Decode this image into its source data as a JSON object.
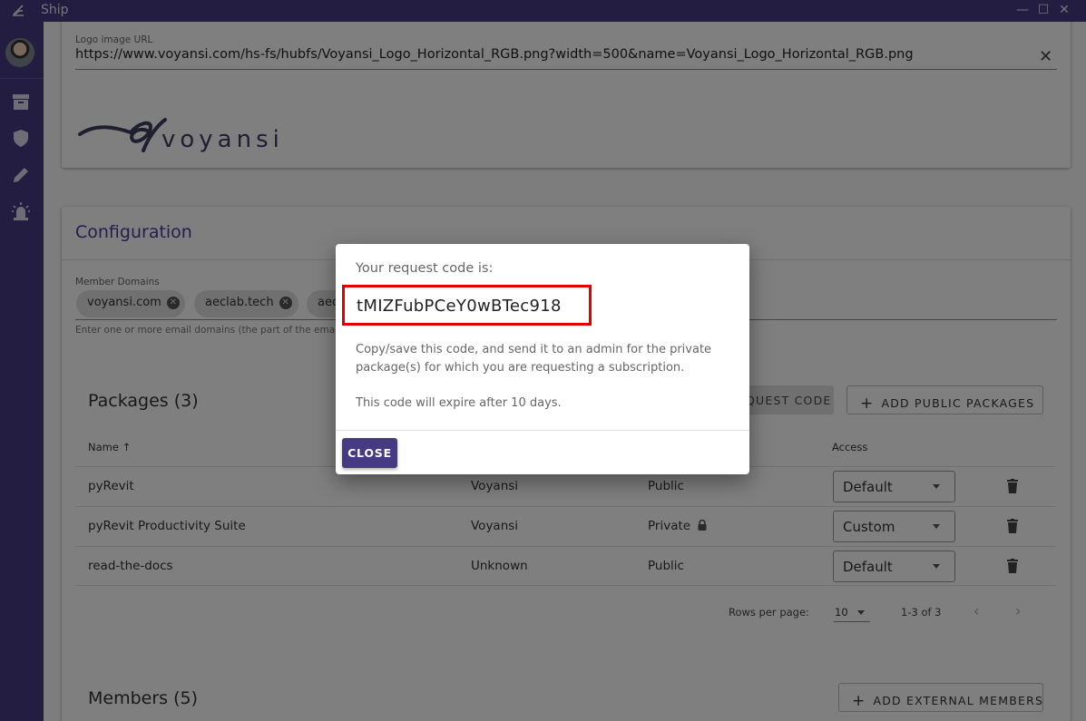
{
  "titlebar": {
    "app_title": "Ship",
    "minimize": "—",
    "maximize": "☐",
    "close": "✕"
  },
  "sidebar": {
    "items": [
      {
        "icon": "archive-icon"
      },
      {
        "icon": "shield-icon"
      },
      {
        "icon": "pencil-icon"
      },
      {
        "icon": "alarm-light-icon"
      }
    ]
  },
  "branding": {
    "logo_url_label": "Logo image URL",
    "logo_url_value": "https://www.voyansi.com/hs-fs/hubfs/Voyansi_Logo_Horizontal_RGB.png?width=500&name=Voyansi_Logo_Horizontal_RGB.png",
    "clear_icon": "✕"
  },
  "configuration": {
    "title": "Configuration",
    "member_domains_label": "Member Domains",
    "domains": [
      "voyansi.com",
      "aeclab.tech",
      "aec"
    ],
    "chip_remove_icon": "✕",
    "domains_help": "Enter one or more email domains (the part of the email"
  },
  "packages": {
    "title": "Packages (3)",
    "request_code_button": "QUEST CODE",
    "add_public_button": "ADD PUBLIC PACKAGES",
    "columns": {
      "name": "Name",
      "sort_icon": "↑",
      "access": "Access"
    },
    "rows": [
      {
        "name": "pyRevit",
        "author": "Voyansi",
        "visibility": "Public",
        "locked": false,
        "access": "Default"
      },
      {
        "name": "pyRevit Productivity Suite",
        "author": "Voyansi",
        "visibility": "Private",
        "locked": true,
        "access": "Custom"
      },
      {
        "name": "read-the-docs",
        "author": "Unknown",
        "visibility": "Public",
        "locked": false,
        "access": "Default"
      }
    ],
    "rows_per_page_label": "Rows per page:",
    "rows_per_page": "10",
    "range": "1-3 of 3"
  },
  "members": {
    "title": "Members (5)",
    "add_external_button": "ADD EXTERNAL MEMBERS"
  },
  "dialog": {
    "title": "Your request code is:",
    "code": "tMIZFubPCeY0wBTec918",
    "message": "Copy/save this code, and send it to an admin for the private package(s) for which you are requesting a subscription.",
    "expiry": "This code will expire after 10 days.",
    "close_button": "CLOSE"
  },
  "colors": {
    "brand": "#473a85",
    "highlight": "#e00000",
    "overlay": "rgba(0,0,0,0.5)"
  }
}
